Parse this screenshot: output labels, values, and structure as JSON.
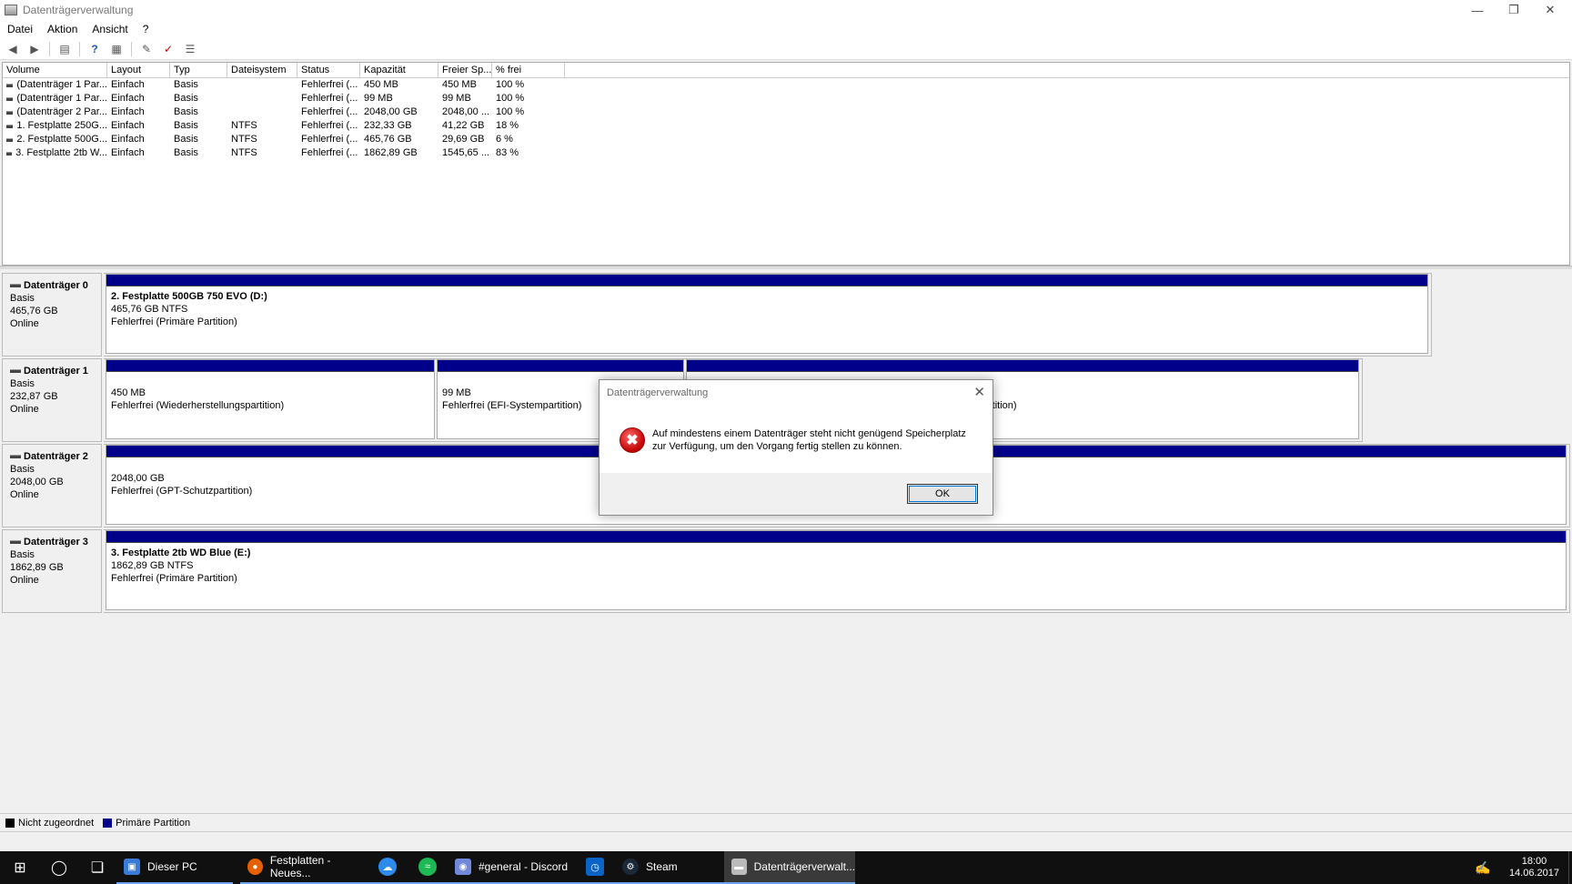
{
  "window": {
    "title": "Datenträgerverwaltung"
  },
  "menu": [
    "Datei",
    "Aktion",
    "Ansicht",
    "?"
  ],
  "volume_list": {
    "columns": [
      "Volume",
      "Layout",
      "Typ",
      "Dateisystem",
      "Status",
      "Kapazität",
      "Freier Sp...",
      "% frei"
    ],
    "rows": [
      [
        "(Datenträger 1 Par...",
        "Einfach",
        "Basis",
        "",
        "Fehlerfrei (...",
        "450 MB",
        "450 MB",
        "100 %"
      ],
      [
        "(Datenträger 1 Par...",
        "Einfach",
        "Basis",
        "",
        "Fehlerfrei (...",
        "99 MB",
        "99 MB",
        "100 %"
      ],
      [
        "(Datenträger 2 Par...",
        "Einfach",
        "Basis",
        "",
        "Fehlerfrei (...",
        "2048,00 GB",
        "2048,00 ...",
        "100 %"
      ],
      [
        "1. Festplatte 250G...",
        "Einfach",
        "Basis",
        "NTFS",
        "Fehlerfrei (...",
        "232,33 GB",
        "41,22 GB",
        "18 %"
      ],
      [
        "2. Festplatte 500G...",
        "Einfach",
        "Basis",
        "NTFS",
        "Fehlerfrei (...",
        "465,76 GB",
        "29,69 GB",
        "6 %"
      ],
      [
        "3. Festplatte 2tb W...",
        "Einfach",
        "Basis",
        "NTFS",
        "Fehlerfrei (...",
        "1862,89 GB",
        "1545,65 ...",
        "83 %"
      ]
    ]
  },
  "disks": [
    {
      "name": "Datenträger 0",
      "type": "Basis",
      "size": "465,76 GB",
      "state": "Online",
      "partitions": [
        {
          "title": "2. Festplatte 500GB 750 EVO  (D:)",
          "line1": "465,76 GB NTFS",
          "line2": "Fehlerfrei (Primäre Partition)"
        }
      ]
    },
    {
      "name": "Datenträger 1",
      "type": "Basis",
      "size": "232,87 GB",
      "state": "Online",
      "partitions": [
        {
          "title": "",
          "line1": "450 MB",
          "line2": "Fehlerfrei (Wiederherstellungspartition)"
        },
        {
          "title": "",
          "line1": "99 MB",
          "line2": "Fehlerfrei (EFI-Systempartition)"
        },
        {
          "title": "",
          "line1": "",
          "line2": "rtition)"
        }
      ]
    },
    {
      "name": "Datenträger 2",
      "type": "Basis",
      "size": "2048,00 GB",
      "state": "Online",
      "partitions": [
        {
          "title": "",
          "line1": "2048,00 GB",
          "line2": "Fehlerfrei (GPT-Schutzpartition)"
        }
      ]
    },
    {
      "name": "Datenträger 3",
      "type": "Basis",
      "size": "1862,89 GB",
      "state": "Online",
      "partitions": [
        {
          "title": "3. Festplatte 2tb WD Blue  (E:)",
          "line1": "1862,89 GB NTFS",
          "line2": "Fehlerfrei (Primäre Partition)"
        }
      ]
    }
  ],
  "legend": [
    {
      "label": "Nicht zugeordnet",
      "color": "#000000"
    },
    {
      "label": "Primäre Partition",
      "color": "#00008b"
    }
  ],
  "dialog": {
    "title": "Datenträgerverwaltung",
    "message": "Auf mindestens einem Datenträger steht nicht genügend Speicherplatz zur Verfügung, um den Vorgang fertig stellen zu können.",
    "ok_label": "OK",
    "icon": "error-icon"
  },
  "taskbar": {
    "apps": [
      {
        "label": "Dieser PC",
        "icon": "explorer-icon"
      },
      {
        "label": "Festplatten - Neues...",
        "icon": "firefox-icon"
      },
      {
        "label": "#general - Discord",
        "icon": "discord-icon"
      },
      {
        "label": "Steam",
        "icon": "steam-icon"
      },
      {
        "label": "Datenträgerverwalt...",
        "icon": "disk-management-icon"
      }
    ],
    "time": "18:00",
    "date": "14.06.2017"
  },
  "colors": {
    "partition_bar": "#00008b",
    "taskbar": "#101010",
    "accent": "#0078d7",
    "error": "#c00000"
  }
}
